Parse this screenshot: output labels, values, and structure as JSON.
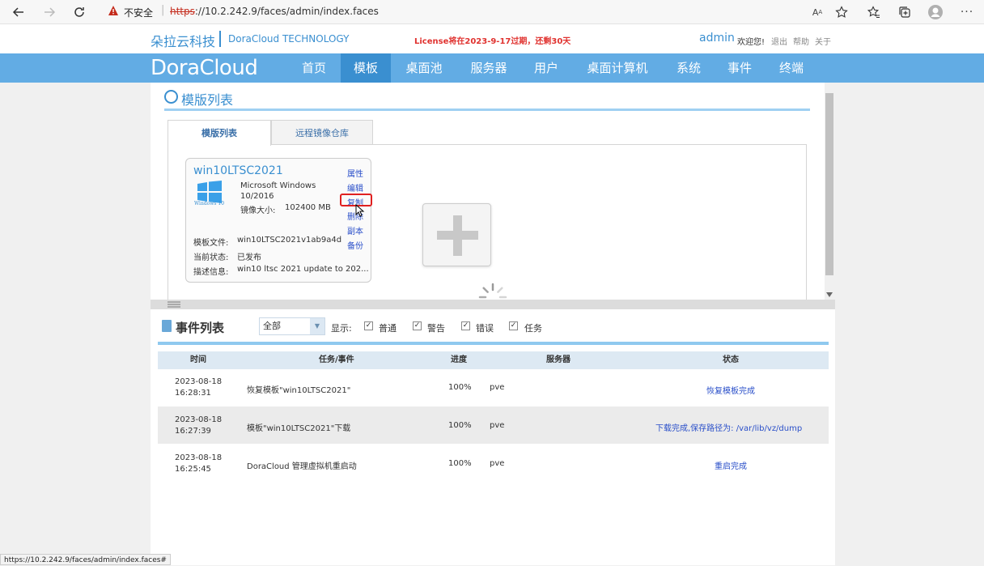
{
  "browser": {
    "insecure_label": "不安全",
    "url_scheme": "https",
    "url_rest": "://10.2.242.9/faces/admin/index.faces",
    "icons": [
      "back-icon",
      "forward-icon",
      "refresh-icon",
      "read-aloud-icon",
      "favorite-add-icon",
      "favorites-icon",
      "collections-icon",
      "profile-icon",
      "more-icon"
    ]
  },
  "header": {
    "brand_cn": "朵拉云科技",
    "brand_en": "DoraCloud TECHNOLOGY",
    "license": "License将在2023-9-17过期，还剩30天",
    "user": "admin",
    "welcome": "欢迎您!",
    "logout": "退出",
    "help": "帮助",
    "about": "关于"
  },
  "nav": {
    "logo": "DoraCloud",
    "items": [
      "首页",
      "模板",
      "桌面池",
      "服务器",
      "用户",
      "桌面计算机",
      "系统",
      "事件",
      "终端"
    ],
    "active": "模板"
  },
  "templates": {
    "title": "模版列表",
    "tabs": [
      "模版列表",
      "远程镜像仓库"
    ],
    "card": {
      "name": "win10LTSC2021",
      "os_line1": "Microsoft Windows",
      "os_line2": "10/2016",
      "size_label": "镜像大小:",
      "size_value": "102400 MB",
      "logo_text": "Windows 10",
      "file_label": "模板文件:",
      "file_value": "win10LTSC2021v1ab9a4d",
      "state_label": "当前状态:",
      "state_value": "已发布",
      "desc_label": "描述信息:",
      "desc_value": "win10 ltsc 2021 update to 202...",
      "actions": [
        "属性",
        "编辑",
        "复制",
        "删除",
        "副本",
        "备份"
      ]
    }
  },
  "events": {
    "title": "事件列表",
    "filter_value": "全部",
    "show_label": "显示:",
    "filters": [
      "普通",
      "警告",
      "错误",
      "任务"
    ],
    "columns": [
      "时间",
      "任务/事件",
      "进度",
      "服务器",
      "状态"
    ],
    "rows": [
      {
        "date": "2023-08-18",
        "time": "16:28:31",
        "event": "恢复模板\"win10LTSC2021\"",
        "progress": "100%",
        "server": "pve",
        "status": "恢复模板完成"
      },
      {
        "date": "2023-08-18",
        "time": "16:27:39",
        "event": "模板\"win10LTSC2021\"下载",
        "progress": "100%",
        "server": "pve",
        "status": "下载完成,保存路径为: /var/lib/vz/dump"
      },
      {
        "date": "2023-08-18",
        "time": "16:25:45",
        "event": "DoraCloud 管理虚拟机重启动",
        "progress": "100%",
        "server": "pve",
        "status": "重启完成"
      }
    ]
  },
  "status_url": "https://10.2.242.9/faces/admin/index.faces#"
}
